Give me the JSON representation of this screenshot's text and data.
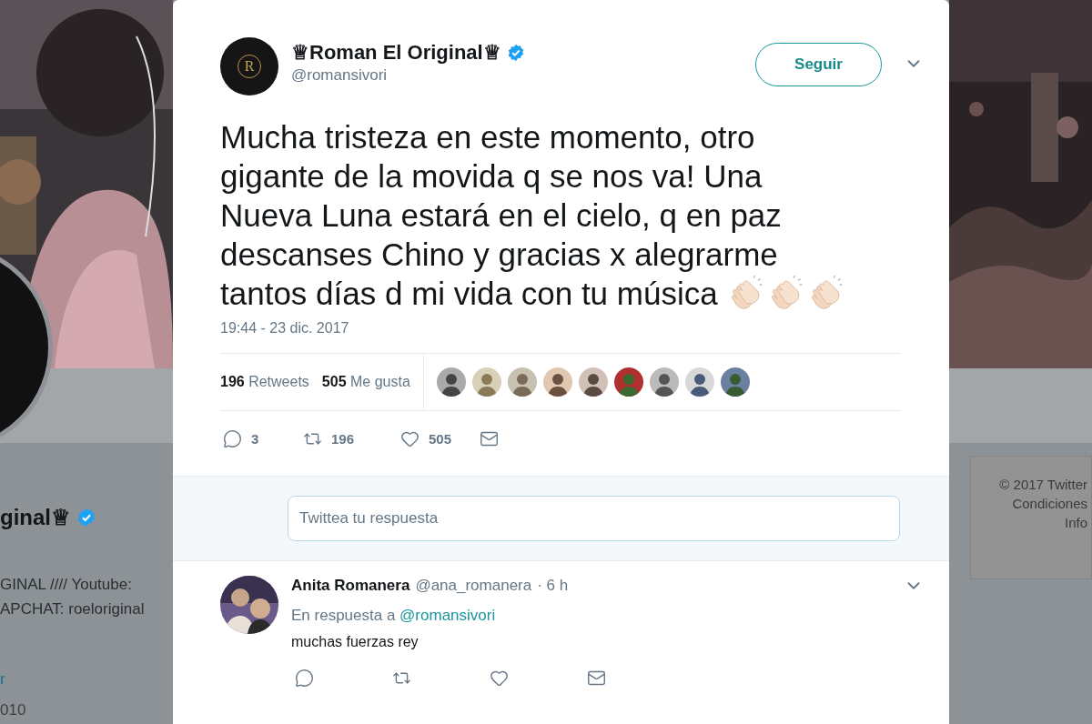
{
  "background_profile": {
    "name_fragment": "ginal♕",
    "verified": true,
    "bio_lines": [
      "GINAL //// Youtube:",
      "APCHAT: roeloriginal"
    ],
    "link_fragment": "r",
    "joined_fragment": "010"
  },
  "sidebar_footer": {
    "lines": [
      "© 2017 Twitter",
      "Condiciones",
      "Info"
    ]
  },
  "tweet": {
    "author": {
      "name": "♕Roman El Original♕",
      "handle": "@romansivori",
      "verified": true,
      "avatar_letter": "R"
    },
    "follow_button": "Seguir",
    "text": "Mucha tristeza en este momento, otro gigante de la movida q se nos va! Una Nueva Luna estará en el cielo, q en paz descanses Chino y gracias x alegrarme tantos días d mi vida con tu música",
    "emojis": [
      {
        "kind": "clap"
      },
      {
        "kind": "clap"
      },
      {
        "kind": "clap"
      }
    ],
    "timestamp": "19:44 - 23 dic. 2017",
    "stats": [
      {
        "count": "196",
        "label": "Retweets"
      },
      {
        "count": "505",
        "label": "Me gusta"
      }
    ],
    "likers": [
      {
        "kind": "avatar"
      },
      {
        "kind": "avatar"
      },
      {
        "kind": "avatar"
      },
      {
        "kind": "avatar"
      },
      {
        "kind": "avatar"
      },
      {
        "kind": "avatar"
      },
      {
        "kind": "avatar"
      },
      {
        "kind": "avatar"
      },
      {
        "kind": "avatar"
      }
    ],
    "actions": [
      {
        "kind": "reply",
        "count": "3"
      },
      {
        "kind": "retweet",
        "count": "196"
      },
      {
        "kind": "like",
        "count": "505"
      },
      {
        "kind": "message"
      }
    ]
  },
  "reply_box": {
    "placeholder": "Twittea tu respuesta"
  },
  "replies": [
    {
      "name": "Anita Romanera",
      "handle": "@ana_romanera",
      "time": "· 6 h",
      "reply_to_label": "En respuesta a",
      "reply_to": "@romansivori",
      "text": "muchas fuerzas rey",
      "actions": [
        {
          "kind": "reply"
        },
        {
          "kind": "retweet"
        },
        {
          "kind": "like"
        },
        {
          "kind": "message"
        }
      ]
    }
  ]
}
